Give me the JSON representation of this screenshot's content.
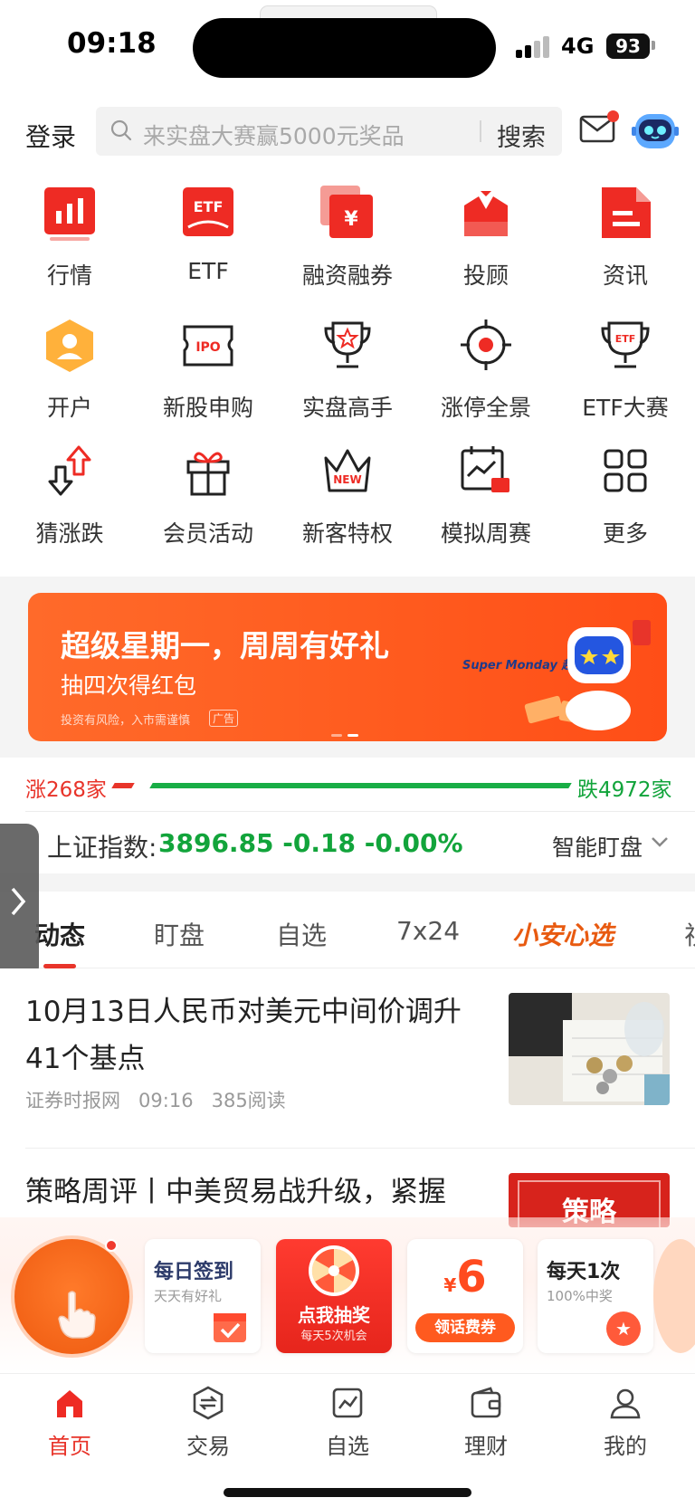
{
  "status_bar": {
    "time": "09:18",
    "network": "4G",
    "battery": "93"
  },
  "header": {
    "login": "登录",
    "search_placeholder": "来实盘大赛赢5000元奖品",
    "search_button": "搜索"
  },
  "grid": [
    {
      "label": "行情",
      "icon": "market-chart-icon"
    },
    {
      "label": "ETF",
      "icon": "etf-icon"
    },
    {
      "label": "融资融券",
      "icon": "margin-trading-icon"
    },
    {
      "label": "投顾",
      "icon": "advisor-icon"
    },
    {
      "label": "资讯",
      "icon": "news-doc-icon"
    },
    {
      "label": "开户",
      "icon": "open-account-icon"
    },
    {
      "label": "新股申购",
      "icon": "ipo-icon"
    },
    {
      "label": "实盘高手",
      "icon": "trophy-star-icon"
    },
    {
      "label": "涨停全景",
      "icon": "target-icon"
    },
    {
      "label": "ETF大赛",
      "icon": "etf-trophy-icon"
    },
    {
      "label": "猜涨跌",
      "icon": "up-down-arrows-icon"
    },
    {
      "label": "会员活动",
      "icon": "gift-icon"
    },
    {
      "label": "新客特权",
      "icon": "new-crown-icon"
    },
    {
      "label": "模拟周赛",
      "icon": "calendar-chart-icon"
    },
    {
      "label": "更多",
      "icon": "grid-more-icon"
    }
  ],
  "banner": {
    "title": "超级星期一，周周有好礼",
    "subtitle": "抽四次得红包",
    "disclaimer": "投资有风险，入市需谨慎",
    "ad_tag": "广告",
    "art_text": "Super Monday 超级星期一"
  },
  "breadth": {
    "up": "涨268家",
    "down": "跌4972家"
  },
  "index": {
    "name": "上证指数:",
    "value": "3896.85 -0.18 -0.00%",
    "watch": "智能盯盘"
  },
  "tabs": [
    "动态",
    "盯盘",
    "自选",
    "7x24",
    "小安心选",
    "视"
  ],
  "news": [
    {
      "title": "10月13日人民币对美元中间价调升41个基点",
      "source": "证券时报网",
      "time": "09:16",
      "reads": "385阅读"
    },
    {
      "title": "策略周评丨中美贸易战升级，紧握",
      "thumb_text": "策略"
    }
  ],
  "promo": {
    "checkin_title": "每日签到",
    "checkin_sub": "天天有好礼",
    "lottery_title": "点我抽奖",
    "lottery_sub": "每天5次机会",
    "money_symbol": "¥",
    "money_amount": "6",
    "money_button": "领话费券",
    "daily_title": "每天1次",
    "daily_sub": "100%中奖"
  },
  "tabbar": [
    {
      "label": "首页",
      "icon": "home-icon",
      "active": true
    },
    {
      "label": "交易",
      "icon": "trade-icon",
      "active": false
    },
    {
      "label": "自选",
      "icon": "watchlist-icon",
      "active": false
    },
    {
      "label": "理财",
      "icon": "wallet-icon",
      "active": false
    },
    {
      "label": "我的",
      "icon": "profile-icon",
      "active": false
    }
  ],
  "colors": {
    "brand_red": "#e8342a",
    "up_red": "#e8342a",
    "down_green": "#12a43b",
    "banner_orange": "#ff5a1e"
  }
}
